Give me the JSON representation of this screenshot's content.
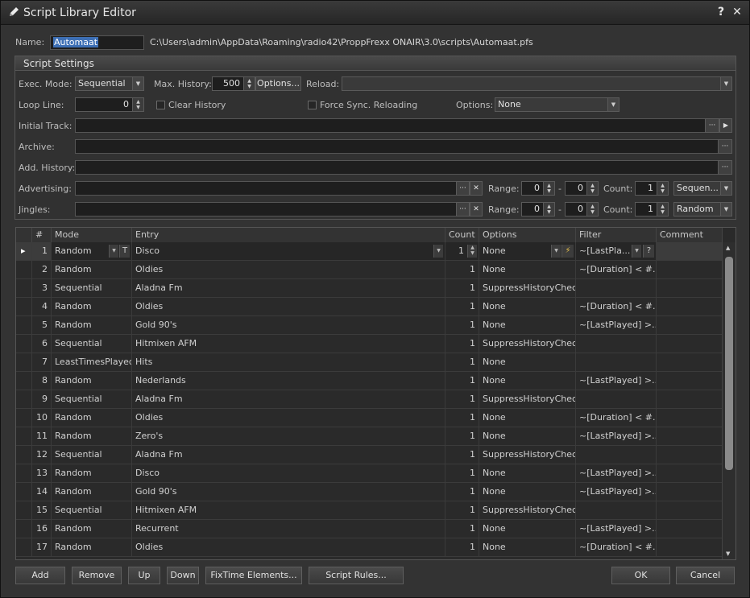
{
  "window": {
    "title": "Script Library Editor",
    "help_label": "?",
    "close_label": "✕"
  },
  "name_row": {
    "label": "Name:",
    "value": "Automaat",
    "path": "C:\\Users\\admin\\AppData\\Roaming\\radio42\\ProppFrexx ONAIR\\3.0\\scripts\\Automaat.pfs"
  },
  "settings": {
    "title": "Script Settings",
    "exec_mode_label": "Exec. Mode:",
    "exec_mode_value": "Sequential",
    "max_history_label": "Max. History:",
    "max_history_value": "500",
    "options_button": "Options...",
    "reload_label": "Reload:",
    "reload_value": "",
    "loop_line_label": "Loop Line:",
    "loop_line_value": "0",
    "clear_history_label": "Clear History",
    "force_sync_label": "Force Sync. Reloading",
    "options_label": "Options:",
    "options_value": "None",
    "initial_track_label": "Initial Track:",
    "archive_label": "Archive:",
    "add_history_label": "Add. History:",
    "advertising_label": "Advertising:",
    "jingles_label": "Jingles:",
    "range_label": "Range:",
    "range_dash": "-",
    "count_label": "Count:",
    "adv_range_from": "0",
    "adv_range_to": "0",
    "adv_count": "1",
    "adv_mode": "Sequen...",
    "jin_range_from": "0",
    "jin_range_to": "0",
    "jin_count": "1",
    "jin_mode": "Random",
    "ellipsis": "···",
    "clear_x": "✕"
  },
  "grid": {
    "columns": [
      "#",
      "Mode",
      "Entry",
      "Count",
      "Options",
      "Filter",
      "Comment"
    ],
    "rows": [
      {
        "n": "1",
        "mode": "Random",
        "entry": "Disco",
        "count": "1",
        "options": "None",
        "filter": "~[LastPla...",
        "comment": ""
      },
      {
        "n": "2",
        "mode": "Random",
        "entry": "Oldies",
        "count": "1",
        "options": "None",
        "filter": "~[Duration] < #...",
        "comment": ""
      },
      {
        "n": "3",
        "mode": "Sequential",
        "entry": "Aladna Fm",
        "count": "1",
        "options": "SuppressHistoryCheck",
        "filter": "",
        "comment": ""
      },
      {
        "n": "4",
        "mode": "Random",
        "entry": "Oldies",
        "count": "1",
        "options": "None",
        "filter": "~[Duration] < #...",
        "comment": ""
      },
      {
        "n": "5",
        "mode": "Random",
        "entry": "Gold 90's",
        "count": "1",
        "options": "None",
        "filter": "~[LastPlayed] >...",
        "comment": ""
      },
      {
        "n": "6",
        "mode": "Sequential",
        "entry": "Hitmixen AFM",
        "count": "1",
        "options": "SuppressHistoryCheck",
        "filter": "",
        "comment": ""
      },
      {
        "n": "7",
        "mode": "LeastTimesPlayed",
        "entry": "Hits",
        "count": "1",
        "options": "None",
        "filter": "",
        "comment": ""
      },
      {
        "n": "8",
        "mode": "Random",
        "entry": "Nederlands",
        "count": "1",
        "options": "None",
        "filter": "~[LastPlayed] >...",
        "comment": ""
      },
      {
        "n": "9",
        "mode": "Sequential",
        "entry": "Aladna Fm",
        "count": "1",
        "options": "SuppressHistoryCheck",
        "filter": "",
        "comment": ""
      },
      {
        "n": "10",
        "mode": "Random",
        "entry": "Oldies",
        "count": "1",
        "options": "None",
        "filter": "~[Duration] < #...",
        "comment": ""
      },
      {
        "n": "11",
        "mode": "Random",
        "entry": "Zero's",
        "count": "1",
        "options": "None",
        "filter": "~[LastPlayed] >...",
        "comment": ""
      },
      {
        "n": "12",
        "mode": "Sequential",
        "entry": "Aladna Fm",
        "count": "1",
        "options": "SuppressHistoryCheck",
        "filter": "",
        "comment": ""
      },
      {
        "n": "13",
        "mode": "Random",
        "entry": "Disco",
        "count": "1",
        "options": "None",
        "filter": "~[LastPlayed] >...",
        "comment": ""
      },
      {
        "n": "14",
        "mode": "Random",
        "entry": "Gold 90's",
        "count": "1",
        "options": "None",
        "filter": "~[LastPlayed] >...",
        "comment": ""
      },
      {
        "n": "15",
        "mode": "Sequential",
        "entry": "Hitmixen AFM",
        "count": "1",
        "options": "SuppressHistoryCheck",
        "filter": "",
        "comment": ""
      },
      {
        "n": "16",
        "mode": "Random",
        "entry": "Recurrent",
        "count": "1",
        "options": "None",
        "filter": "~[LastPlayed] >...",
        "comment": ""
      },
      {
        "n": "17",
        "mode": "Random",
        "entry": "Oldies",
        "count": "1",
        "options": "None",
        "filter": "~[Duration] < #...",
        "comment": ""
      }
    ],
    "row1_t_button": "T",
    "row1_filter_help": "?"
  },
  "buttons": {
    "add": "Add",
    "remove": "Remove",
    "up": "Up",
    "down": "Down",
    "fixtime": "FixTime Elements...",
    "rules": "Script Rules...",
    "ok": "OK",
    "cancel": "Cancel"
  }
}
